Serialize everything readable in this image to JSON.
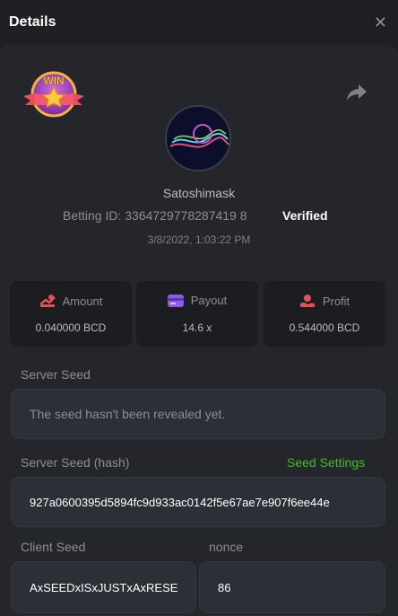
{
  "header": {
    "title": "Details",
    "close_icon": "close-icon"
  },
  "badge": {
    "text": "WIN"
  },
  "player": {
    "username": "Satoshimask",
    "betting_id": "Betting ID: 3364729778287419 8",
    "verified": "Verified",
    "datetime": "3/8/2022, 1:03:22 PM"
  },
  "stats": {
    "amount": {
      "label": "Amount",
      "value": "0.040000 BCD",
      "icon": "amount-icon",
      "color": "#e54e5a"
    },
    "payout": {
      "label": "Payout",
      "value": "14.6 x",
      "icon": "payout-card-icon",
      "color": "#8f5ee8"
    },
    "profit": {
      "label": "Profit",
      "value": "0.544000 BCD",
      "icon": "profit-hand-icon",
      "color": "#e54e5a"
    }
  },
  "server_seed": {
    "label": "Server Seed",
    "value": "The seed hasn't been revealed yet."
  },
  "server_seed_hash": {
    "label": "Server Seed (hash)",
    "settings_link": "Seed Settings",
    "value": "927a0600395d5894fc9d933ac0142f5e67ae7e907f6ee44e"
  },
  "client_seed": {
    "label": "Client Seed",
    "value": "AxSEEDxISxJUSTxAxRESE"
  },
  "nonce": {
    "label": "nonce",
    "value": "86"
  },
  "colors": {
    "accent_green": "#3bc117",
    "panel": "#24262b",
    "background": "#1e2024"
  }
}
